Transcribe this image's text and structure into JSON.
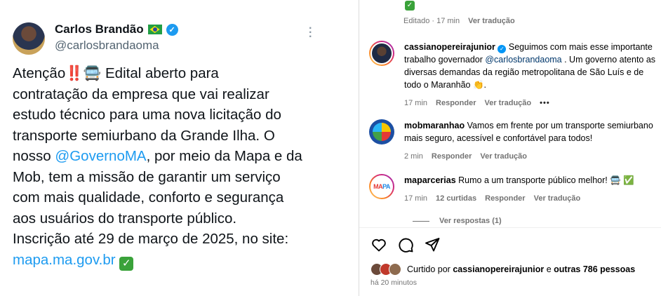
{
  "tweet": {
    "name": "Carlos Brandão",
    "handle": "@carlosbrandaoma",
    "text_1": "Atenção",
    "text_2": " Edital aberto para\ncontratação da empresa que vai realizar\nestudo técnico para uma nova licitação do\ntransporte semiurbano da Grande Ilha. O\nnosso ",
    "mention": "@GovernoMA",
    "text_3": ", por meio da Mapa e da\nMob, tem a missão de garantir um serviço\ncom mais qualidade, conforto e segurança\naos usuários do transporte público.\nInscrição até 29 de março de 2025, no site:\n",
    "link": "mapa.ma.gov.br",
    "emoji_alert": "‼️",
    "emoji_bus": "🚍",
    "emoji_check": "✓",
    "icons": {
      "verified": "verified-badge-icon",
      "flag": "brazil-flag-icon",
      "more": "more-options-icon"
    }
  },
  "panel": {
    "top_meta": {
      "edited": "Editado · 17 min",
      "translate": "Ver tradução"
    },
    "comments": [
      {
        "user": "cassianopereirajunior",
        "text_before": " Seguimos com mais esse importante trabalho governador ",
        "mention": "@carlosbrandaoma",
        "text_after": " . Um governo atento as diversas demandas da região metropolitana de São Luís e de todo o Maranhão 👏.",
        "time": "17 min",
        "reply": "Responder",
        "translate": "Ver tradução",
        "more": "•••"
      },
      {
        "user": "mobmaranhao",
        "text": " Vamos em frente por um transporte semiurbano mais seguro, acessível e confortável para todos!",
        "time": "2 min",
        "reply": "Responder",
        "translate": "Ver tradução"
      },
      {
        "user": "maparcerias",
        "text": " Rumo a um transporte público melhor! 🚍 ✅",
        "time": "17 min",
        "likes": "12 curtidas",
        "reply": "Responder",
        "translate": "Ver tradução"
      }
    ],
    "view_replies": "Ver respostas (1)",
    "liked_by_prefix": "Curtido por ",
    "liked_by_user": "cassianopereirajunior",
    "liked_by_mid": " e ",
    "liked_by_others": "outras 786 pessoas",
    "posted": "há 20 minutos",
    "colors": {
      "link": "#1d9bf0",
      "mention": "#00376b",
      "muted": "#737373"
    }
  }
}
